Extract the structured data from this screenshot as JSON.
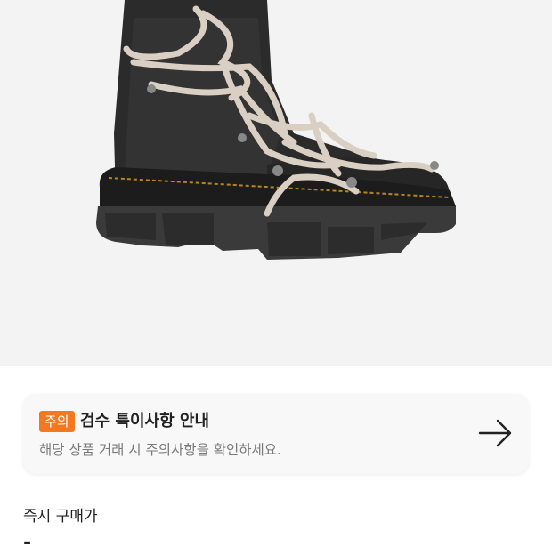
{
  "notice": {
    "badge": "주의",
    "title": "검수 특이사항 안내",
    "subtitle": "해당 상품 거래 시 주의사항을 확인하세요.",
    "arrow_icon": "arrow-right-icon",
    "badge_color": "#f4781f"
  },
  "instant_buy": {
    "label": "즉시 구매가",
    "price": "-"
  },
  "product_image": {
    "icon": "boot-image"
  }
}
